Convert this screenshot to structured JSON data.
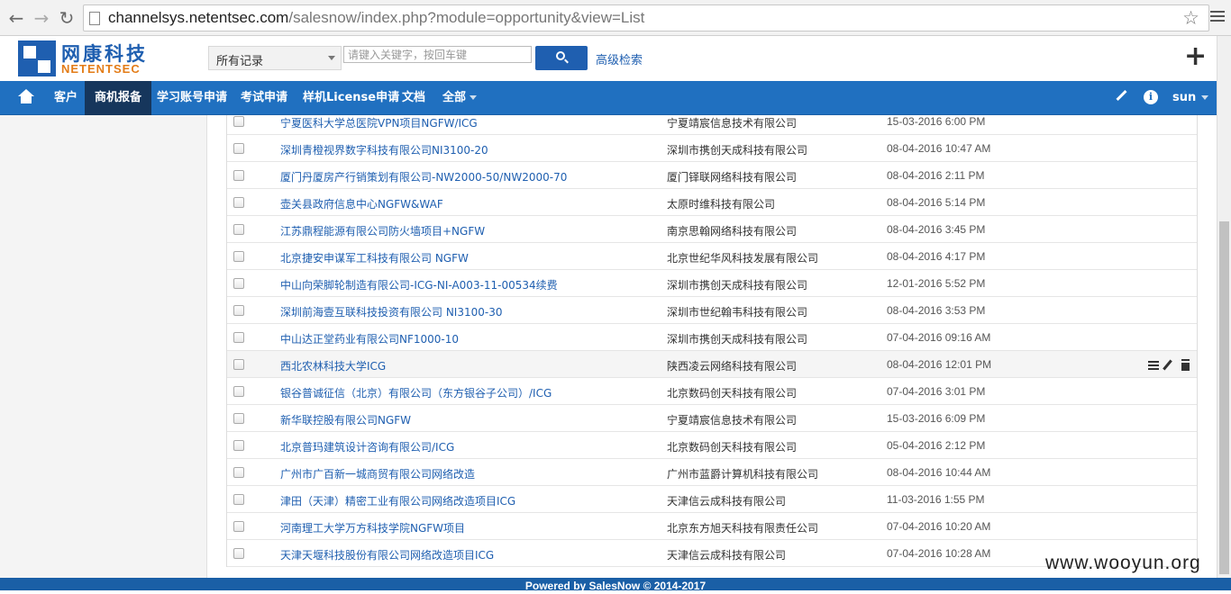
{
  "browser": {
    "url_host": "channelsys.netentsec.com",
    "url_rest": "/salesnow/index.php?module=opportunity&view=List"
  },
  "header": {
    "logo_cn": "网康科技",
    "logo_en": "NETENTSEC",
    "scope_selected": "所有记录",
    "search_placeholder": "请键入关键字，按回车键",
    "advanced_search": "高级检索"
  },
  "nav": {
    "items": [
      {
        "label": "客户"
      },
      {
        "label": "商机报备"
      },
      {
        "label": "学习账号申请"
      },
      {
        "label": "考试申请"
      },
      {
        "label": "样机License申请"
      },
      {
        "label": "文档"
      },
      {
        "label": "全部"
      }
    ],
    "user": "sun"
  },
  "rows": [
    {
      "name": "宁夏医科大学总医院VPN项目NGFW/ICG",
      "company": "宁夏靖宸信息技术有限公司",
      "date": "15-03-2016 6:00 PM"
    },
    {
      "name": "深圳青橙视界数字科技有限公司NI3100-20",
      "company": "深圳市携创天成科技有限公司",
      "date": "08-04-2016 10:47 AM"
    },
    {
      "name": "厦门丹厦房产行销策划有限公司-NW2000-50/NW2000-70",
      "company": "厦门铎联网络科技有限公司",
      "date": "08-04-2016 2:11 PM"
    },
    {
      "name": "壶关县政府信息中心NGFW&WAF",
      "company": "太原时维科技有限公司",
      "date": "08-04-2016 5:14 PM"
    },
    {
      "name": "江苏鼎程能源有限公司防火墙项目+NGFW",
      "company": "南京思翰网络科技有限公司",
      "date": "08-04-2016 3:45 PM"
    },
    {
      "name": "北京捷安申谋军工科技有限公司 NGFW",
      "company": "北京世纪华风科技发展有限公司",
      "date": "08-04-2016 4:17 PM"
    },
    {
      "name": "中山向荣脚轮制造有限公司-ICG-NI-A003-11-00534续费",
      "company": "深圳市携创天成科技有限公司",
      "date": "12-01-2016 5:52 PM"
    },
    {
      "name": "深圳前海壹互联科技投资有限公司 NI3100-30",
      "company": "深圳市世纪翰韦科技有限公司",
      "date": "08-04-2016 3:53 PM"
    },
    {
      "name": "中山达正堂药业有限公司NF1000-10",
      "company": "深圳市携创天成科技有限公司",
      "date": "07-04-2016 09:16 AM"
    },
    {
      "name": "西北农林科技大学ICG",
      "company": "陕西凌云网络科技有限公司",
      "date": "08-04-2016 12:01 PM"
    },
    {
      "name": "银谷普诚征信（北京）有限公司（东方银谷子公司）/ICG",
      "company": "北京数码创天科技有限公司",
      "date": "07-04-2016 3:01 PM"
    },
    {
      "name": "新华联控股有限公司NGFW",
      "company": "宁夏靖宸信息技术有限公司",
      "date": "15-03-2016 6:09 PM"
    },
    {
      "name": "北京普玛建筑设计咨询有限公司/ICG",
      "company": "北京数码创天科技有限公司",
      "date": "05-04-2016 2:12 PM"
    },
    {
      "name": "广州市广百新一城商贸有限公司网络改造",
      "company": "广州市蓝爵计算机科技有限公司",
      "date": "08-04-2016 10:44 AM"
    },
    {
      "name": "津田（天津）精密工业有限公司网络改造项目ICG",
      "company": "天津信云成科技有限公司",
      "date": "11-03-2016 1:55 PM"
    },
    {
      "name": "河南理工大学万方科技学院NGFW项目",
      "company": "北京东方旭天科技有限责任公司",
      "date": "07-04-2016 10:20 AM"
    },
    {
      "name": "天津天堰科技股份有限公司网络改造项目ICG",
      "company": "天津信云成科技有限公司",
      "date": "07-04-2016 10:28 AM"
    }
  ],
  "footer": {
    "text": "Powered by SalesNow © 2014-2017"
  },
  "watermark": "www.wooyun.org"
}
